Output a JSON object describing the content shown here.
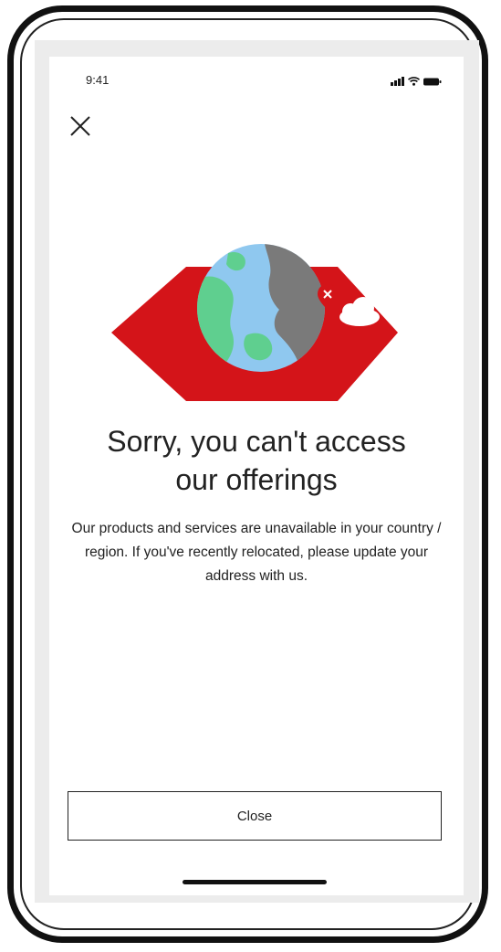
{
  "status_bar": {
    "time": "9:41",
    "icons": [
      "signal-icon",
      "wifi-icon",
      "battery-icon"
    ]
  },
  "header": {
    "close_icon": "close-icon"
  },
  "illustration": {
    "name": "globe-restricted-illustration",
    "colors": {
      "hexagon": "#d41419",
      "ocean": "#8fc8ef",
      "land": "#5fcf8f",
      "restricted_area": "#7a7a7a",
      "pin": "#d41419",
      "cloud": "#ffffff"
    }
  },
  "message": {
    "title": "Sorry, you can't access our offerings",
    "body": "Our products and services are unavailable in your country / region. If you've recently relocated, please update your address with us."
  },
  "actions": {
    "close_label": "Close"
  }
}
